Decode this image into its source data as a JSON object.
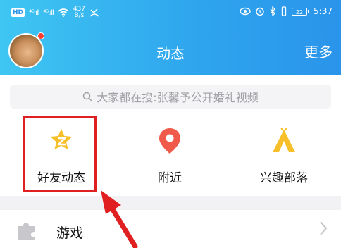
{
  "status_bar": {
    "hd_badge": "HD",
    "signal1": "⁴ᴳ.ıll",
    "signal2": "⁴ᴳ.ıll",
    "net_speed_value": "437",
    "net_speed_unit": "B/s",
    "battery": "22",
    "time": "5:37"
  },
  "header": {
    "title": "动态",
    "more": "更多"
  },
  "search": {
    "placeholder": "大家都在搜:张馨予公开婚礼视频"
  },
  "tiles": [
    {
      "label": "好友动态",
      "icon": "friend-star-icon"
    },
    {
      "label": "附近",
      "icon": "location-pin-icon"
    },
    {
      "label": "兴趣部落",
      "icon": "tent-icon"
    }
  ],
  "list": {
    "games_label": "游戏"
  },
  "colors": {
    "header_start": "#3fc6f2",
    "header_end": "#2a94ea",
    "highlight": "#e02020",
    "pin_red": "#f05a4a",
    "star_yellow": "#f7c02a"
  }
}
